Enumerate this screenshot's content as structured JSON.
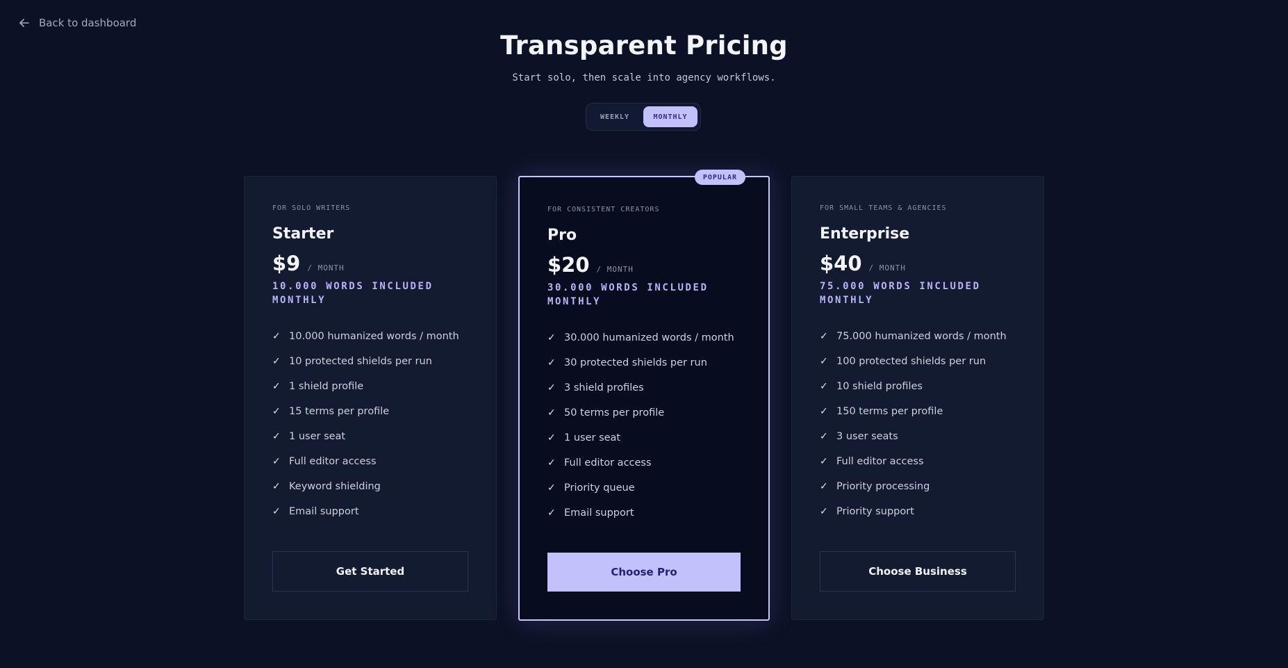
{
  "nav": {
    "back_label": "Back to dashboard"
  },
  "header": {
    "title": "Transparent Pricing",
    "subtitle": "Start solo, then scale into agency workflows."
  },
  "billing_toggle": {
    "options": [
      "WEEKLY",
      "MONTHLY"
    ],
    "selected": "MONTHLY"
  },
  "plans": [
    {
      "eyebrow": "FOR SOLO WRITERS",
      "name": "Starter",
      "price": "$9",
      "period": "/ MONTH",
      "words": "10.000 WORDS INCLUDED MONTHLY",
      "features": [
        "10.000 humanized words / month",
        "10 protected shields per run",
        "1 shield profile",
        "15 terms per profile",
        "1 user seat",
        "Full editor access",
        "Keyword shielding",
        "Email support"
      ],
      "cta": "Get Started"
    },
    {
      "badge": "POPULAR",
      "eyebrow": "FOR CONSISTENT CREATORS",
      "name": "Pro",
      "price": "$20",
      "period": "/ MONTH",
      "words": "30.000 WORDS INCLUDED MONTHLY",
      "features": [
        "30.000 humanized words / month",
        "30 protected shields per run",
        "3 shield profiles",
        "50 terms per profile",
        "1 user seat",
        "Full editor access",
        "Priority queue",
        "Email support"
      ],
      "cta": "Choose Pro"
    },
    {
      "eyebrow": "FOR SMALL TEAMS & AGENCIES",
      "name": "Enterprise",
      "price": "$40",
      "period": "/ MONTH",
      "words": "75.000 WORDS INCLUDED MONTHLY",
      "features": [
        "75.000 humanized words / month",
        "100 protected shields per run",
        "10 shield profiles",
        "150 terms per profile",
        "3 user seats",
        "Full editor access",
        "Priority processing",
        "Priority support"
      ],
      "cta": "Choose Business"
    }
  ],
  "icons": {
    "back": "arrow-left-icon",
    "check": "check-icon",
    "check_glyph": "✓"
  },
  "colors": {
    "background": "#0b1226",
    "accent": "#c2c1fb",
    "accent_text": "#2c2f8a"
  }
}
